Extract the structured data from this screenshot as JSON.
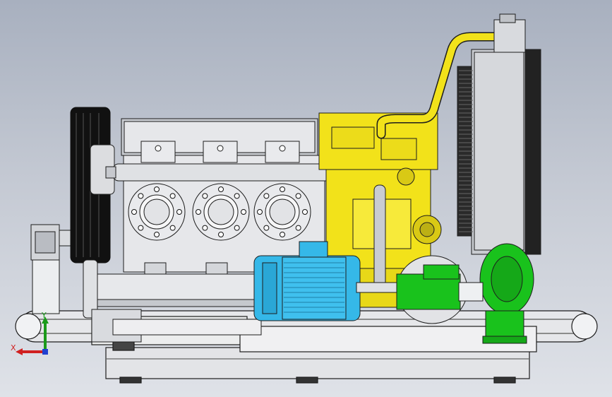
{
  "viewport": {
    "background_top": "#a8b0bf",
    "background_bottom": "#dfe2e8"
  },
  "model": {
    "colors": {
      "engine_yellow": "#f2e21a",
      "pump_green": "#19c21c",
      "motor_blue": "#35b8e8",
      "steel_light": "#e6e7ea",
      "steel_mid": "#c9ccd1",
      "edge_dark": "#1d1d1d",
      "radiator_dark": "#2a2a2a",
      "tire_black": "#111111"
    }
  },
  "triad": {
    "x_label": "X",
    "y_label": "Y",
    "x_color": "#d02020",
    "y_color": "#1a9a1a",
    "z_color": "#2040d0"
  }
}
